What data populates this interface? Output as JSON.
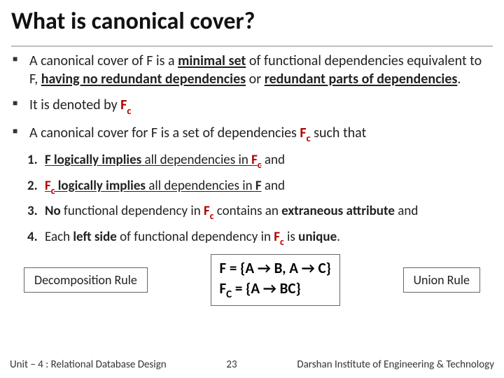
{
  "title": "What is canonical cover?",
  "bullets": {
    "b1": {
      "pre": "A canonical cover of F is a ",
      "bold1": "minimal set",
      "mid1": " of functional dependencies equivalent to F, ",
      "bold2": "having no redundant dependencies",
      "mid2": " or ",
      "bold3": "redundant parts of dependencies",
      "post": "."
    },
    "b2": {
      "pre": "It is denoted by ",
      "fc": "F",
      "sub": "c"
    },
    "b3": {
      "pre": "A canonical cover for F is a set of dependencies ",
      "fc": "F",
      "sub": "c",
      "post": " such that"
    }
  },
  "nums": {
    "n1": {
      "a": "F logically implies",
      "b": " all dependencies in ",
      "c": "F",
      "d": "c",
      "e": " and"
    },
    "n2": {
      "a": "F",
      "b": "c",
      "c": " logically implies",
      "d": " all dependencies in ",
      "e": "F",
      "f": " and"
    },
    "n3": {
      "a": "No",
      "b": " functional dependency in ",
      "c": "F",
      "d": "c",
      "e": " contains an ",
      "f": "extraneous attribute",
      "g": " and"
    },
    "n4": {
      "a": "Each ",
      "b": "left side",
      "c": " of functional dependency in ",
      "d": "F",
      "e": "c",
      "f": " is ",
      "g": "unique",
      "h": "."
    }
  },
  "rules": {
    "left": "Decomposition Rule",
    "fd_f": "F = {A → B, A → C}",
    "fd_fc_pre": "F",
    "fd_fc_sub": "C",
    "fd_fc_post": " = {A → BC}",
    "right": "Union Rule"
  },
  "footer": {
    "left": "Unit – 4 : Relational Database Design",
    "page": "23",
    "right": "Darshan Institute of Engineering & Technology"
  }
}
